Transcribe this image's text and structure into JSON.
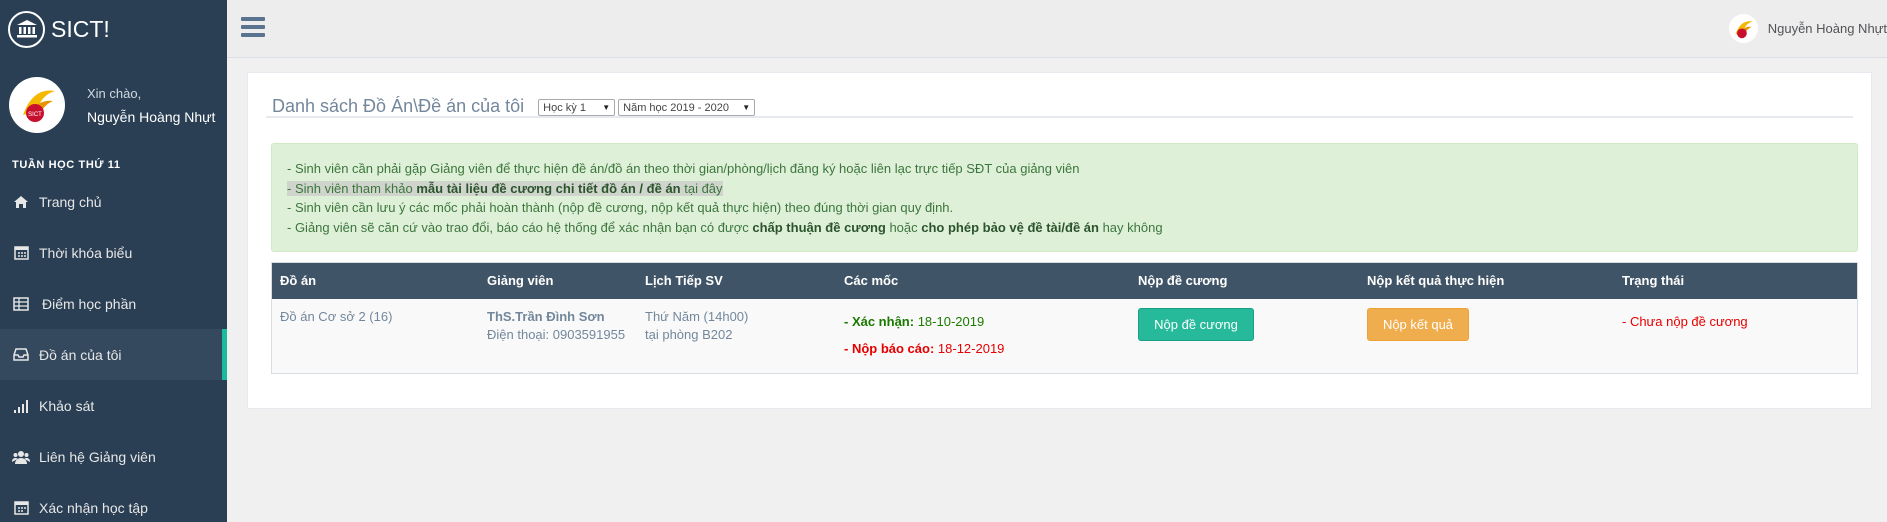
{
  "brand": {
    "name": "SICT!",
    "icon": "institution-icon"
  },
  "profile": {
    "greeting": "Xin chào,",
    "name": "Nguyễn Hoàng Nhựt"
  },
  "sidebar": {
    "week_label": "TUẦN HỌC THỨ 11",
    "items": [
      {
        "label": "Trang chủ",
        "icon": "home-icon"
      },
      {
        "label": "Thời khóa biểu",
        "icon": "calendar-icon"
      },
      {
        "label": "Điểm học phần",
        "icon": "table-icon"
      },
      {
        "label": "Đồ án của tôi",
        "icon": "inbox-icon",
        "active": true
      },
      {
        "label": "Khảo sát",
        "icon": "signal-icon"
      },
      {
        "label": "Liên hệ Giảng viên",
        "icon": "users-icon"
      },
      {
        "label": "Xác nhận học tập",
        "icon": "calendar-check-icon"
      }
    ]
  },
  "topnav": {
    "user_name": "Nguyễn Hoàng Nhựt",
    "menu_icon": "hamburger-icon"
  },
  "page": {
    "title": "Danh sách Đồ Án\\Đề án của tôi",
    "semester_select": "Học kỳ 1",
    "year_select": "Năm học 2019 - 2020"
  },
  "notice": {
    "line1": "- Sinh viên cần phải gặp Giảng viên để thực hiện đề án/đồ án theo thời gian/phòng/lịch đăng ký hoặc liên lạc trực tiếp SĐT của giảng viên",
    "line2_pre": "- Sinh viên tham khảo ",
    "line2_bold": "mẫu tài liệu đề cương chi tiết đồ án / đề án",
    "line2_post": " tại đây",
    "line3": "- Sinh viên cần lưu ý các mốc phải hoàn thành (nộp đề cương, nộp kết quả thực hiện) theo đúng thời gian quy định.",
    "line4_pre": "- Giảng viên sẽ căn cứ vào trao đổi, báo cáo hệ thống để xác nhận bạn có được ",
    "line4_b1": "chấp thuận đề cương",
    "line4_mid": " hoặc ",
    "line4_b2": "cho phép bảo vệ đề tài/đề án",
    "line4_post": " hay không"
  },
  "table": {
    "headers": [
      "Đồ án",
      "Giảng viên",
      "Lịch Tiếp SV",
      "Các mốc",
      "Nộp đề cương",
      "Nộp kết quả thực hiện",
      "Trạng thái"
    ],
    "row": {
      "project": "Đồ án Cơ sở 2 (16)",
      "lecturer": "ThS.Trần Đình Sơn",
      "phone": "Điện thoại: 0903591955",
      "schedule_day": "Thứ Năm (14h00)",
      "schedule_room": "tại phòng B202",
      "milestone1_label": "- Xác nhận:",
      "milestone1_date": "18-10-2019",
      "milestone2_label": "- Nộp báo cáo:",
      "milestone2_date": "18-12-2019",
      "submit_outline_btn": "Nộp đề cương",
      "submit_result_btn": "Nộp kết quả",
      "status": "- Chưa nộp đề cương"
    }
  },
  "colors": {
    "sidebar_bg": "#2a3f54",
    "accent": "#1abb9c",
    "table_header": "#405467",
    "btn_green": "#26b99a",
    "btn_orange": "#f0ad4e",
    "status_red": "#e60000"
  }
}
